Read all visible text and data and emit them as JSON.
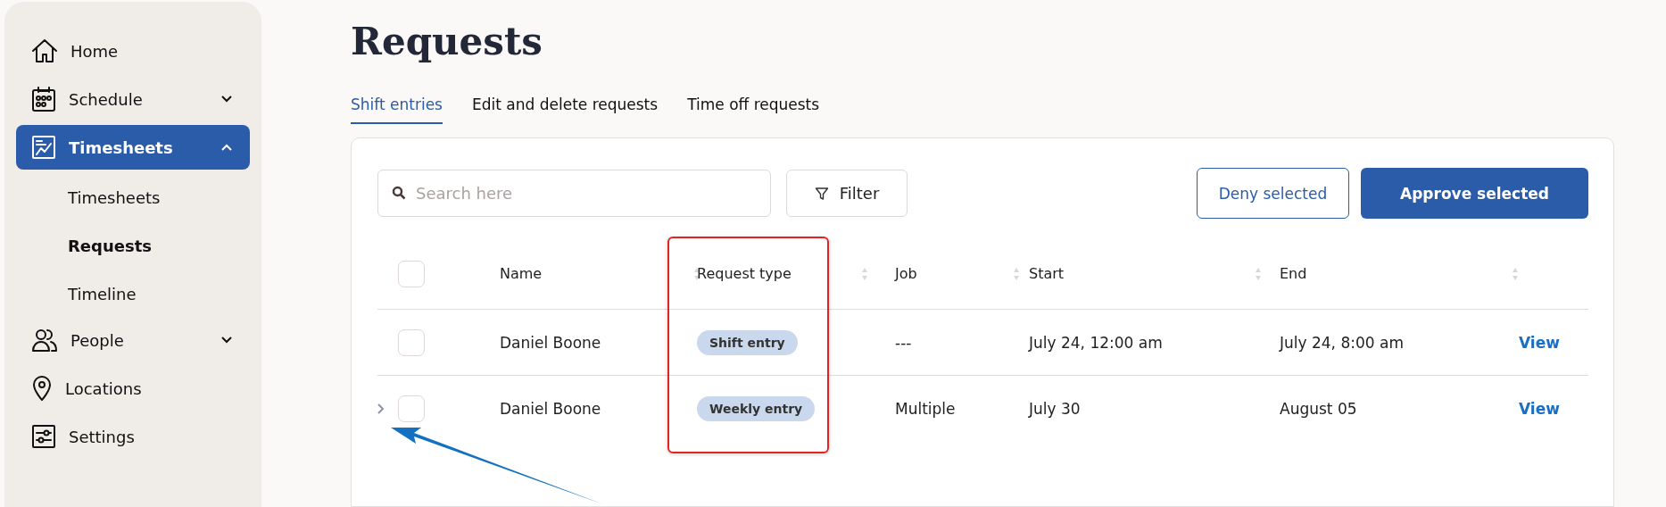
{
  "sidebar": {
    "items": [
      {
        "label": "Home",
        "selected": false
      },
      {
        "label": "Schedule",
        "selected": false,
        "expanded": false
      },
      {
        "label": "Timesheets",
        "selected": true,
        "expanded": true,
        "children": [
          {
            "label": "Timesheets",
            "selected": false
          },
          {
            "label": "Requests",
            "selected": true
          },
          {
            "label": "Timeline",
            "selected": false
          }
        ]
      },
      {
        "label": "People",
        "selected": false,
        "expanded": false
      },
      {
        "label": "Locations",
        "selected": false
      },
      {
        "label": "Settings",
        "selected": false
      }
    ]
  },
  "page": {
    "title": "Requests"
  },
  "tabs": [
    {
      "label": "Shift entries",
      "selected": true
    },
    {
      "label": "Edit and delete requests",
      "selected": false
    },
    {
      "label": "Time off requests",
      "selected": false
    }
  ],
  "toolbar": {
    "search": {
      "placeholder": "Search here"
    },
    "filter": "Filter",
    "deny": "Deny selected",
    "approve": "Approve selected"
  },
  "table": {
    "select_all": {
      "checked": false
    },
    "columns": [
      "Name",
      "Request type",
      "Job",
      "Start",
      "End"
    ],
    "rows": [
      {
        "expandable": false,
        "checked": false,
        "name": "Daniel Boone",
        "request_type": "Shift entry",
        "job": "---",
        "start": "July 24, 12:00 am",
        "end": "July 24, 8:00 am",
        "action": "View"
      },
      {
        "expandable": true,
        "checked": false,
        "name": "Daniel Boone",
        "request_type": "Weekly entry",
        "job": "Multiple",
        "start": "July 30",
        "end": "August 05",
        "action": "View"
      }
    ]
  }
}
